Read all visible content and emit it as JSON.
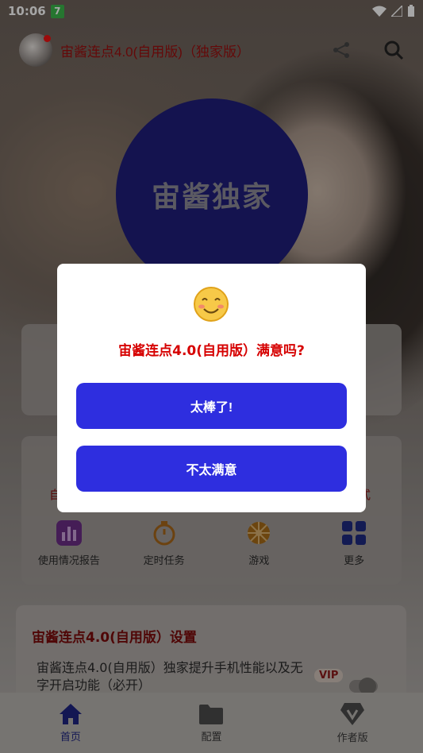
{
  "status": {
    "time": "10:06",
    "badge": "7"
  },
  "header": {
    "title": "宙酱连点4.0(自用版)（独家版）"
  },
  "hero": {
    "circle_text": "宙酱独家"
  },
  "card2": {
    "left_edge_text": "自",
    "right_edge_text": "式",
    "grid": [
      {
        "label": "使用情况报告",
        "icon": "bar-chart-icon"
      },
      {
        "label": "定时任务",
        "icon": "timer-icon"
      },
      {
        "label": "游戏",
        "icon": "game-icon"
      },
      {
        "label": "更多",
        "icon": "more-grid-icon"
      }
    ]
  },
  "settings": {
    "title": "宙酱连点4.0(自用版）设置",
    "description": "宙酱连点4.0(自用版）独家提升手机性能以及无字开启功能（必开）",
    "vip": "VIP"
  },
  "nav": [
    {
      "label": "首页",
      "icon": "home-icon"
    },
    {
      "label": "配置",
      "icon": "folder-icon"
    },
    {
      "label": "作者版",
      "icon": "diamond-icon"
    }
  ],
  "dialog": {
    "title": "宙酱连点4.0(自用版）满意吗?",
    "great_label": "太棒了!",
    "not_label": "不太满意"
  },
  "colors": {
    "accent": "#2e2edf",
    "dialog_title": "#d60000",
    "circle": "#1f1e7a"
  }
}
